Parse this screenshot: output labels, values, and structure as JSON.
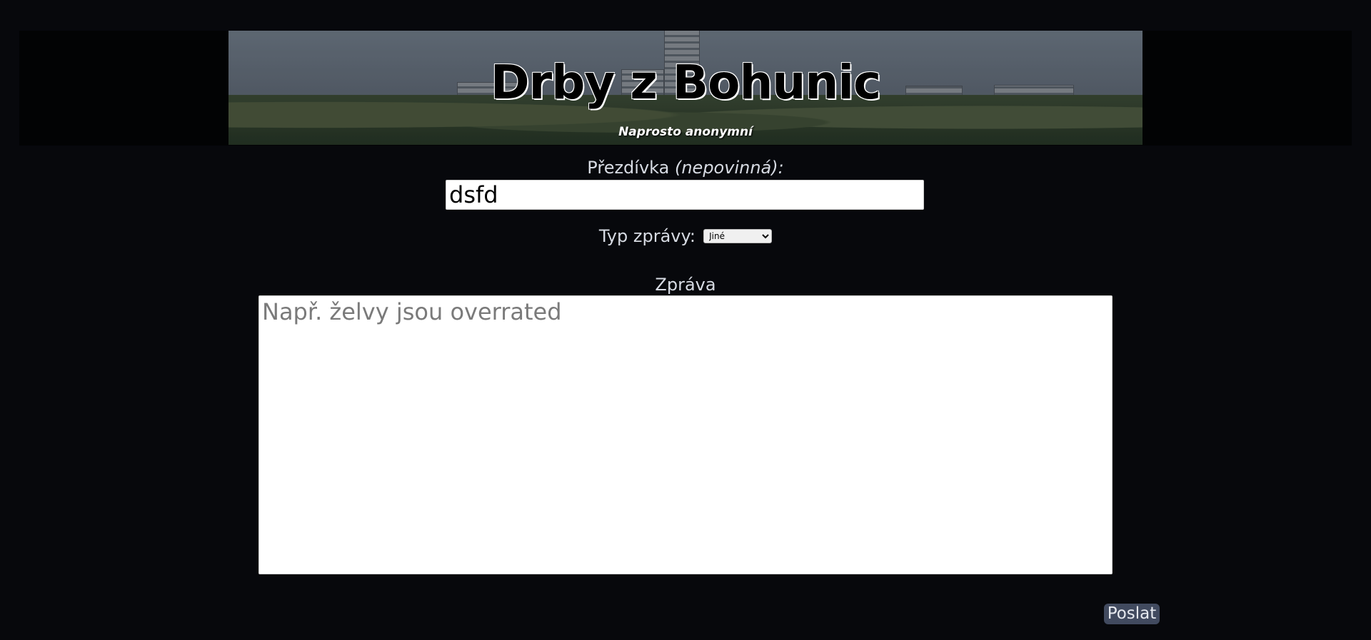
{
  "header": {
    "title": "Drby z Bohunic",
    "subtitle": "Naprosto anonymní"
  },
  "form": {
    "nickname_label": "Přezdívka",
    "nickname_optional": "(nepovinná):",
    "nickname_value": "dsfd",
    "type_label": "Typ zprávy:",
    "type_selected": "Jiné",
    "message_label": "Zpráva",
    "message_placeholder": "Např. želvy jsou overrated",
    "submit_label": "Poslat"
  },
  "colors": {
    "background": "#07080c",
    "button_bg": "#414a5f",
    "text": "#d7dbe3"
  }
}
